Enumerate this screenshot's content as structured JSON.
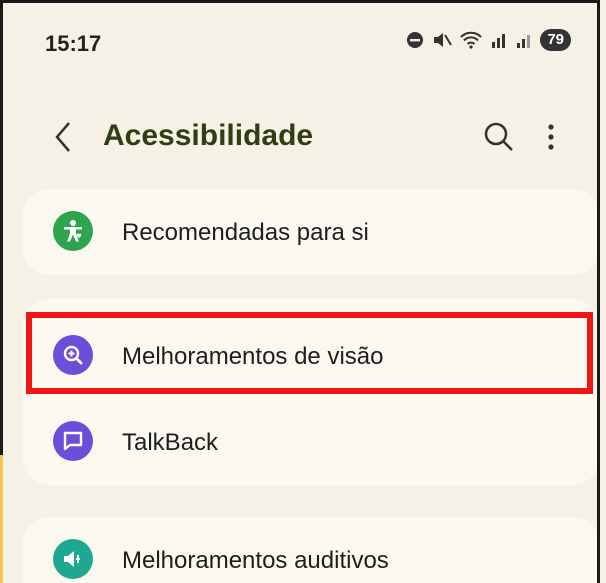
{
  "status_bar": {
    "time": "15:17",
    "battery": "79"
  },
  "app_bar": {
    "title": "Acessibilidade"
  },
  "items": [
    {
      "label": "Recomendadas para si",
      "icon": "accessibility-person-icon",
      "color": "#2ea44f"
    },
    {
      "label": "Melhoramentos de visão",
      "icon": "zoom-in-icon",
      "color": "#6a4fd8",
      "highlighted": true
    },
    {
      "label": "TalkBack",
      "icon": "chat-bubble-icon",
      "color": "#6a4fd8"
    },
    {
      "label": "Melhoramentos auditivos",
      "icon": "speaker-icon",
      "color": "#1fa891"
    }
  ],
  "colors": {
    "background": "#f5f1e6",
    "card": "#fbf8f0",
    "title": "#333d12",
    "highlight": "#f01616"
  }
}
